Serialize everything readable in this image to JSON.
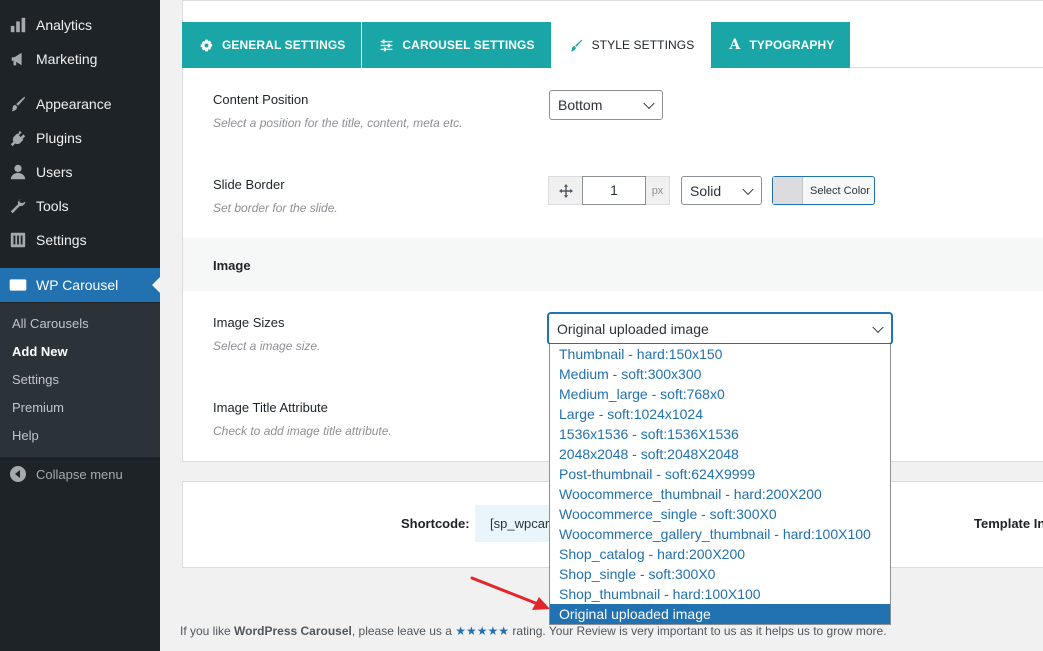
{
  "sidebar": {
    "items": [
      {
        "label": "Analytics",
        "icon": "bar-chart-icon"
      },
      {
        "label": "Marketing",
        "icon": "megaphone-icon"
      },
      {
        "label": "Appearance",
        "icon": "paintbrush-icon"
      },
      {
        "label": "Plugins",
        "icon": "plug-icon"
      },
      {
        "label": "Users",
        "icon": "user-icon"
      },
      {
        "label": "Tools",
        "icon": "wrench-icon"
      },
      {
        "label": "Settings",
        "icon": "sliders-icon"
      },
      {
        "label": "WP Carousel",
        "icon": "carousel-icon"
      }
    ],
    "submenu": [
      "All Carousels",
      "Add New",
      "Settings",
      "Premium",
      "Help"
    ],
    "active_submenu": "Add New",
    "collapse_label": "Collapse menu"
  },
  "tabs": [
    {
      "label": "GENERAL SETTINGS",
      "icon": "gear-icon"
    },
    {
      "label": "CAROUSEL SETTINGS",
      "icon": "sliders-icon"
    },
    {
      "label": "STYLE SETTINGS",
      "icon": "brush-icon"
    },
    {
      "label": "TYPOGRAPHY",
      "icon": "font-icon",
      "glyph": "A"
    }
  ],
  "active_tab": "STYLE SETTINGS",
  "fields": {
    "content_position": {
      "title": "Content Position",
      "desc": "Select a position for the title, content, meta etc.",
      "value": "Bottom"
    },
    "slide_border": {
      "title": "Slide Border",
      "desc": "Set border for the slide.",
      "width": "1",
      "unit": "px",
      "style": "Solid",
      "color_label": "Select Color"
    },
    "image_section": "Image",
    "image_sizes": {
      "title": "Image Sizes",
      "desc": "Select a image size.",
      "value": "Original uploaded image",
      "options": [
        "Thumbnail - hard:150x150",
        "Medium - soft:300x300",
        "Medium_large - soft:768x0",
        "Large - soft:1024x1024",
        "1536x1536 - soft:1536X1536",
        "2048x2048 - soft:2048X2048",
        "Post-thumbnail - soft:624X9999",
        "Woocommerce_thumbnail - hard:200X200",
        "Woocommerce_single - soft:300X0",
        "Woocommerce_gallery_thumbnail - hard:100X100",
        "Shop_catalog - hard:200X200",
        "Shop_single - soft:300X0",
        "Shop_thumbnail - hard:100X100",
        "Original uploaded image"
      ]
    },
    "image_title_attr": {
      "title": "Image Title Attribute",
      "desc": "Check to add image title attribute."
    }
  },
  "shortcode": {
    "label": "Shortcode:",
    "value": "[sp_wpcarousel id=\"...\"]",
    "template_label": "Template In"
  },
  "footer": {
    "prefix": "If you like ",
    "plugin": "WordPress Carousel",
    "middle": ", please leave us a ",
    "stars": "★★★★★",
    "suffix": " rating. Your Review is very important to us as it helps us to grow more."
  },
  "colors": {
    "accent_tab": "#1aa6a6",
    "wp_blue": "#2271b1",
    "annotation_arrow": "#e3262b"
  }
}
